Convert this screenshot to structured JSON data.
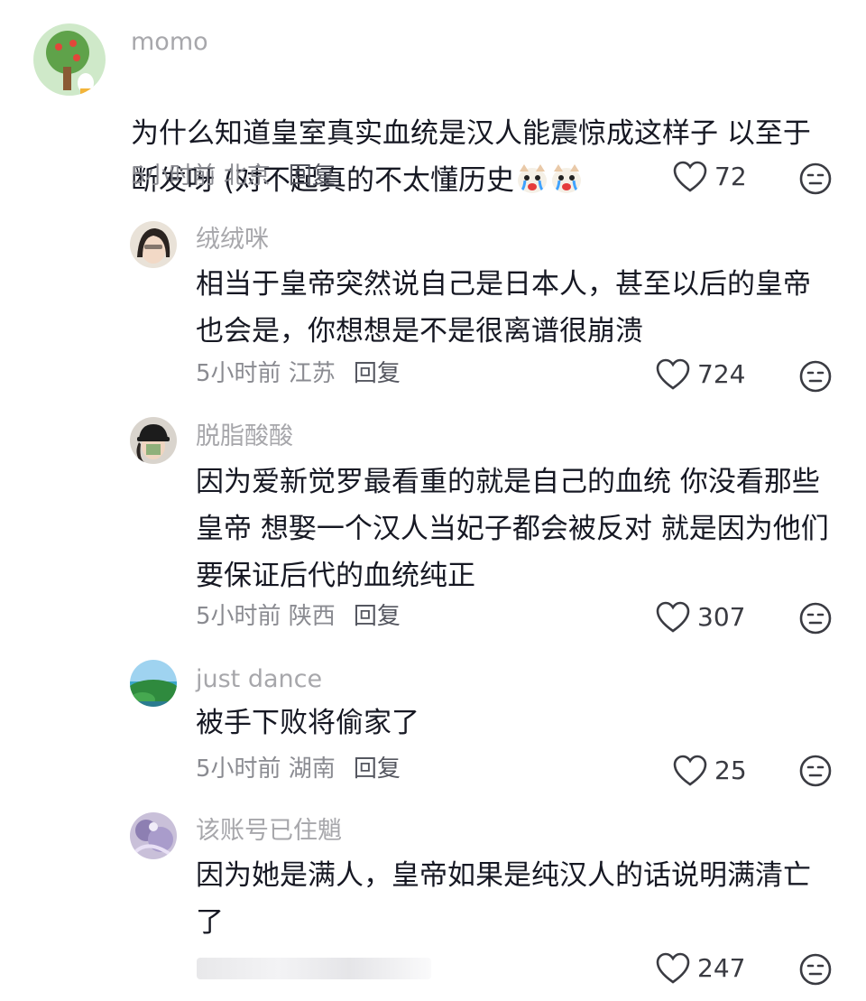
{
  "comments": [
    {
      "username": "momo",
      "content": "为什么知道皇室真实血统是汉人能震惊成这样子 以至于\n断发呀 (对不起真的不太懂历史",
      "time_location": "5小时前 北京",
      "reply_label": "回复",
      "likes": "72",
      "emoji_icons": [
        "crying-dog-emoji",
        "crying-dog-emoji"
      ]
    },
    {
      "username": "绒绒咪",
      "content": "相当于皇帝突然说自己是日本人，甚至以后的皇帝\n也会是，你想想是不是很离谱很崩溃",
      "time_location": "5小时前 江苏",
      "reply_label": "回复",
      "likes": "724"
    },
    {
      "username": "脱脂酸酸",
      "content": "因为爱新觉罗最看重的就是自己的血统 你没看那些\n皇帝 想娶一个汉人当妃子都会被反对 就是因为他们\n要保证后代的血统纯正",
      "time_location": "5小时前 陕西",
      "reply_label": "回复",
      "likes": "307"
    },
    {
      "username": "just dance",
      "content": "被手下败将偷家了",
      "time_location": "5小时前 湖南",
      "reply_label": "回复",
      "likes": "25"
    },
    {
      "username": "该账号已住魈",
      "content": "因为她是满人，皇帝如果是纯汉人的话说明满清亡\n了",
      "time_location": "",
      "reply_label": "",
      "likes": "247"
    }
  ],
  "icons": {
    "like": "heart-outline-icon",
    "dislike": "meh-face-icon"
  },
  "colors": {
    "text": "#161823",
    "username": "#a7a7ab",
    "meta": "#8a8b91"
  }
}
